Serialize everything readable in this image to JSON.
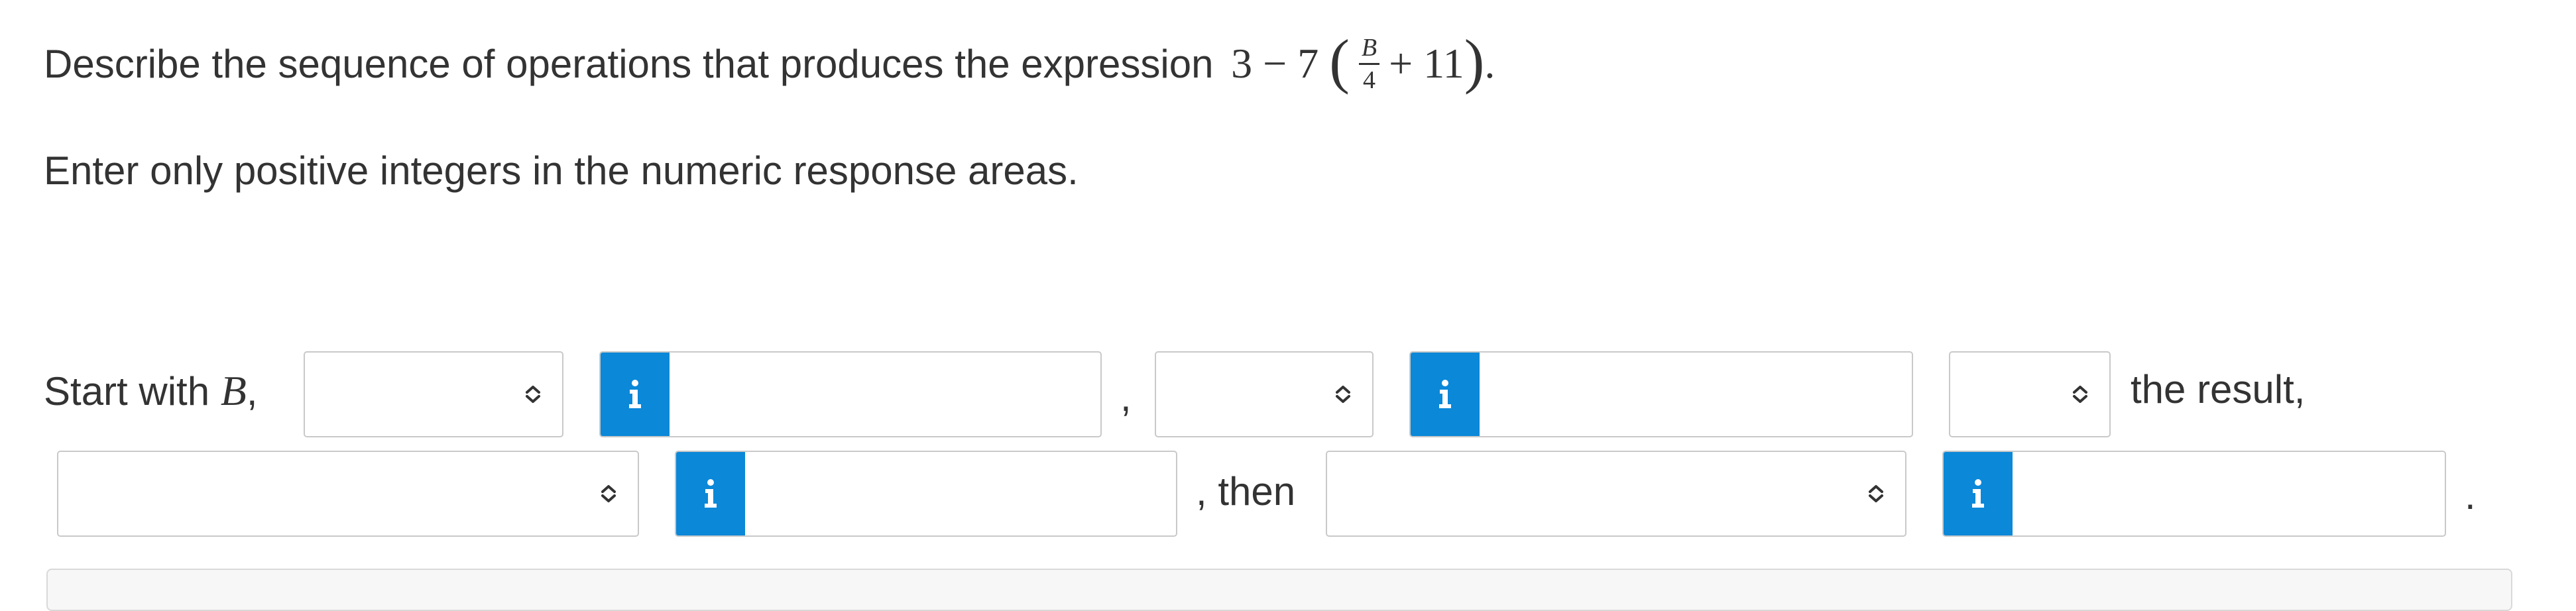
{
  "question": {
    "prompt": "Describe the sequence of operations that produces the expression",
    "expr_lead": "3 − 7",
    "expr_num": "B",
    "expr_den": "4",
    "expr_plus": "+ 11",
    "expr_open": "(",
    "expr_close": ")",
    "expr_end": ".",
    "instructions": "Enter only positive integers in the numeric response areas."
  },
  "row1": {
    "start_text": "Start with",
    "start_var": "B",
    "start_comma": ",",
    "sep_comma": ",",
    "tail_text": "the result,"
  },
  "row2": {
    "then_text": ", then",
    "period": "."
  },
  "inputs": {
    "value_1": "",
    "value_2": "",
    "value_3": "",
    "value_4": ""
  },
  "dropdowns": {
    "op_1": "",
    "op_2": "",
    "op_3": "",
    "op_4": "",
    "op_5": ""
  },
  "icons": {
    "info": "info-icon",
    "chevron": "chevron-up-down-icon"
  },
  "colors": {
    "accent": "#0b88d8",
    "text": "#333333",
    "border": "#c9c9c9"
  }
}
